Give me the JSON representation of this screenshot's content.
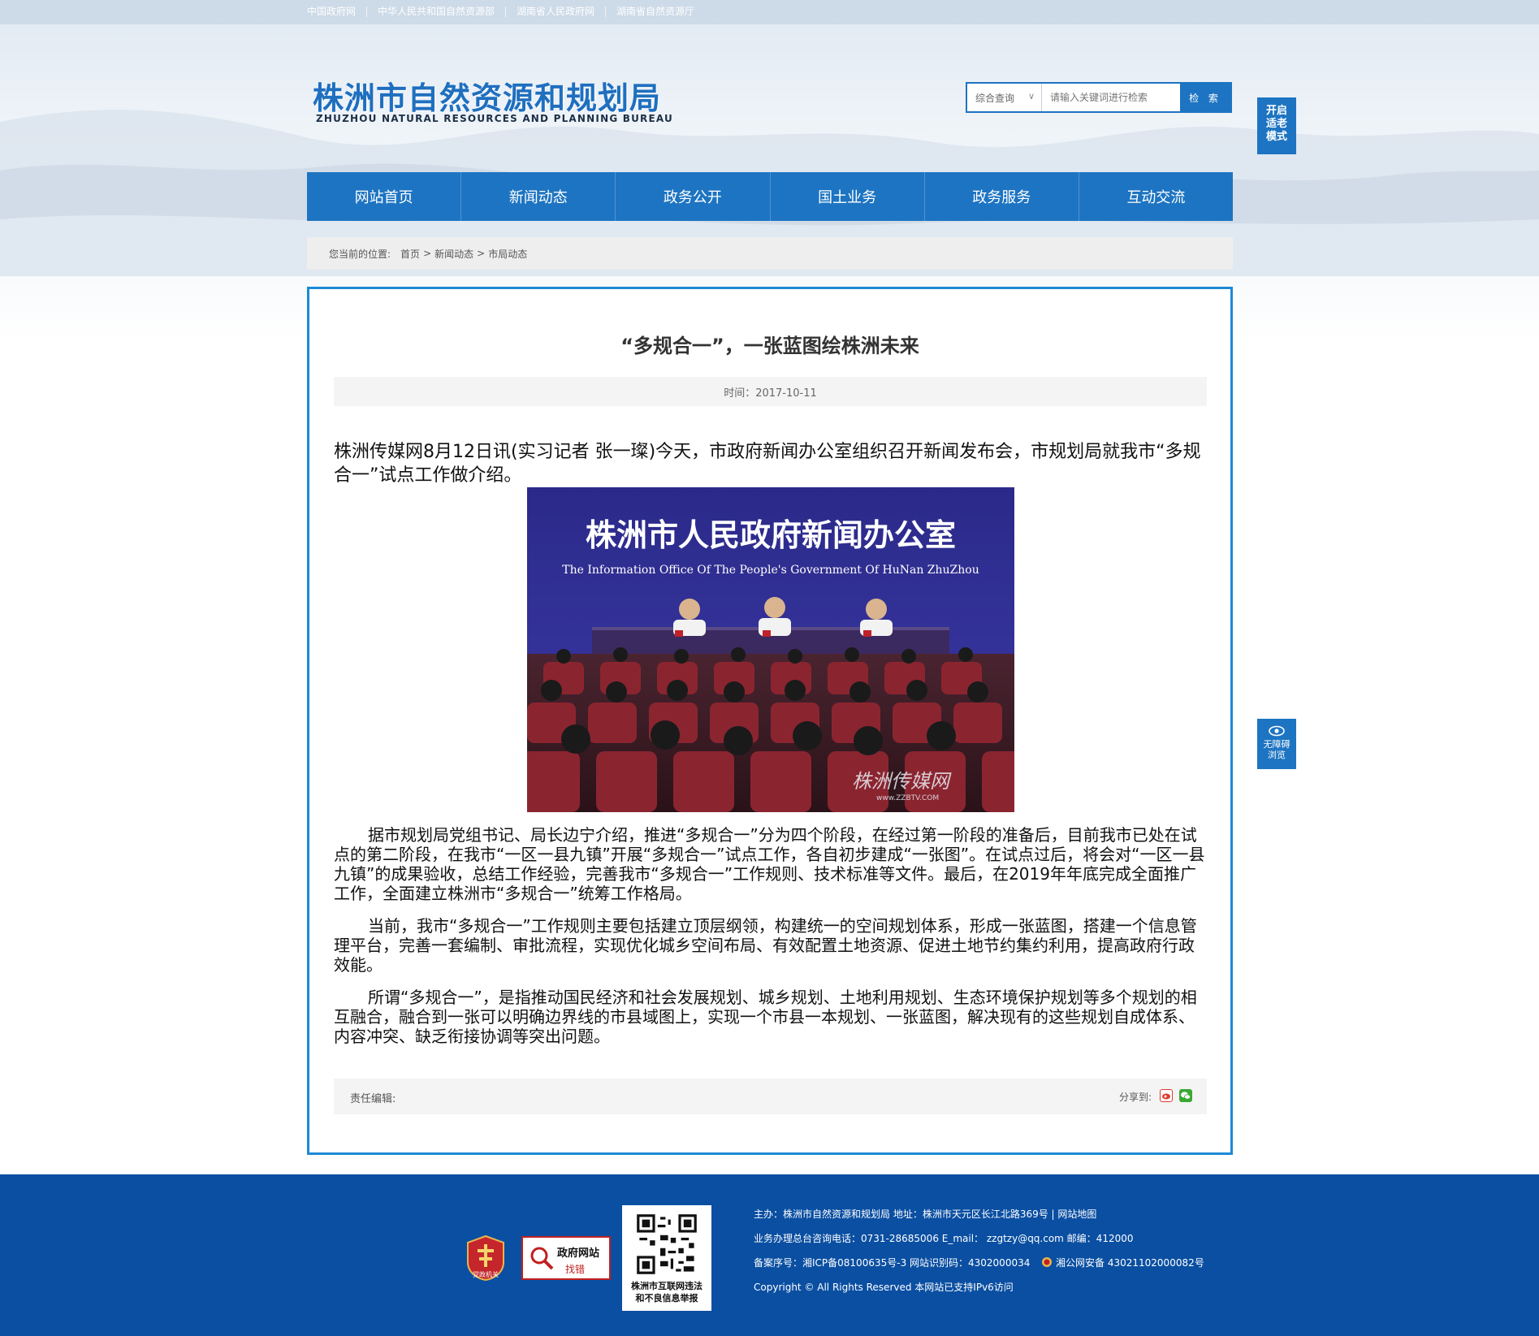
{
  "top_links": [
    "中国政府网",
    "中华人民共和国自然资源部",
    "湖南省人民政府网",
    "湖南省自然资源厅"
  ],
  "logo": {
    "cn": "株洲市自然资源和规划局",
    "en": "ZHUZHOU NATURAL RESOURCES AND PLANNING BUREAU"
  },
  "search": {
    "scope": "综合查询",
    "placeholder": "请输入关键词进行检索",
    "button": "检 索"
  },
  "elder_mode": "开启适老模式",
  "accessibility": {
    "line1": "无障碍",
    "line2": "浏览"
  },
  "nav": [
    "网站首页",
    "新闻动态",
    "政务公开",
    "国土业务",
    "政务服务",
    "互动交流"
  ],
  "breadcrumb": {
    "prefix": "您当前的位置:",
    "items": [
      "首页",
      "新闻动态",
      "市局动态"
    ],
    "sep": ">"
  },
  "article": {
    "title": "“多规合一”，一张蓝图绘株洲未来",
    "time": "时间：2017-10-11",
    "lead": "株洲传媒网8月12日讯(实习记者 张一璨)今天，市政府新闻办公室组织召开新闻发布会，市规划局就我市“多规合一”试点工作做介绍。",
    "photo": {
      "banner_cn": "株洲市人民政府新闻办公室",
      "banner_en": "The Information Office Of The People's Government Of HuNan ZhuZhou",
      "watermark": "株洲传媒网",
      "watermark_url": "www.ZZBTV.COM"
    },
    "paragraphs": [
      "据市规划局党组书记、局长边宁介绍，推进“多规合一”分为四个阶段，在经过第一阶段的准备后，目前我市已处在试点的第二阶段，在我市“一区一县九镇”开展“多规合一”试点工作，各自初步建成“一张图”。在试点过后，将会对“一区一县九镇”的成果验收，总结工作经验，完善我市“多规合一”工作规则、技术标准等文件。最后，在2019年年底完成全面推广工作，全面建立株洲市“多规合一”统筹工作格局。",
      "当前，我市“多规合一”工作规则主要包括建立顶层纲领，构建统一的空间规划体系，形成一张蓝图，搭建一个信息管理平台，完善一套编制、审批流程，实现优化城乡空间布局、有效配置土地资源、促进土地节约集约利用，提高政府行政效能。",
      "所谓“多规合一”，是指推动国民经济和社会发展规划、城乡规划、土地利用规划、生态环境保护规划等多个规划的相互融合，融合到一张可以明确边界线的市县域图上，实现一个市县一本规划、一张蓝图，解决现有的这些规划自成体系、内容冲突、缺乏衔接协调等突出问题。"
    ],
    "editor_label": "责任编辑:",
    "share_label": "分享到:"
  },
  "footer": {
    "badge1_text": "党政机关",
    "badge2_line1": "政府网站",
    "badge2_line2": "找错",
    "qr_caption1": "株洲市互联网违法",
    "qr_caption2": "和不良信息举报",
    "line1": "主办：株洲市自然资源和规划局   地址：株洲市天元区长江北路369号  |  网站地图",
    "line2": "业务办理总台咨询电话：0731-28685006    E_mail：  zzgtzy@qq.com    邮编：412000",
    "line3a": "备案序号：湘ICP备08100635号-3  网站识别码：4302000034",
    "line3b": "湘公网安备 43021102000082号",
    "line4": "Copyright © All Rights Reserved 本网站已支持IPv6访问"
  },
  "colors": {
    "brand": "#1d74c2",
    "footer": "#0a4fa2",
    "panel_border": "#1d8ad6"
  }
}
